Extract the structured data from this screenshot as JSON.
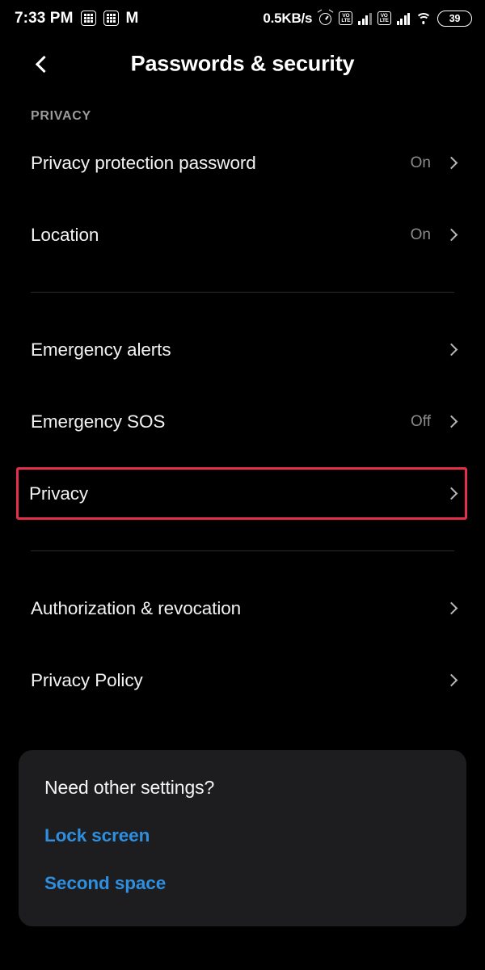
{
  "colors": {
    "background": "#000000",
    "card_background": "#1d1d1f",
    "accent_link": "#2e8fe0",
    "highlight_border": "#e32f49",
    "primary_text": "#f2f2f2",
    "secondary_text": "#8b8b8b",
    "divider": "#2b2b2b"
  },
  "status_bar": {
    "time": "7:33 PM",
    "left_icons": [
      "calculator-icon",
      "calculator-icon",
      "m-logo-icon"
    ],
    "network_speed": "0.5KB/s",
    "right_icons": [
      "alarm-icon",
      "volte-sim1-icon",
      "signal-sim1-icon",
      "volte-sim2-icon",
      "signal-sim2-icon",
      "wifi-icon",
      "battery-icon"
    ],
    "volte_label_top": "VO",
    "volte_label_bottom": "LTE",
    "battery_level": "39"
  },
  "app_bar": {
    "back_icon": "chevron-left-icon",
    "title": "Passwords & security"
  },
  "section_label": "PRIVACY",
  "groups": [
    {
      "rows": [
        {
          "title": "Privacy protection password",
          "value": "On",
          "chevron": "chevron-right-icon",
          "highlighted": false
        },
        {
          "title": "Location",
          "value": "On",
          "chevron": "chevron-right-icon",
          "highlighted": false
        }
      ]
    },
    {
      "rows": [
        {
          "title": "Emergency alerts",
          "value": "",
          "chevron": "chevron-right-icon",
          "highlighted": false
        },
        {
          "title": "Emergency SOS",
          "value": "Off",
          "chevron": "chevron-right-icon",
          "highlighted": false
        },
        {
          "title": "Privacy",
          "value": "",
          "chevron": "chevron-right-icon",
          "highlighted": true
        }
      ]
    },
    {
      "rows": [
        {
          "title": "Authorization & revocation",
          "value": "",
          "chevron": "chevron-right-icon",
          "highlighted": false
        },
        {
          "title": "Privacy Policy",
          "value": "",
          "chevron": "chevron-right-icon",
          "highlighted": false
        }
      ]
    }
  ],
  "bottom_card": {
    "title": "Need other settings?",
    "links": [
      "Lock screen",
      "Second space"
    ]
  }
}
